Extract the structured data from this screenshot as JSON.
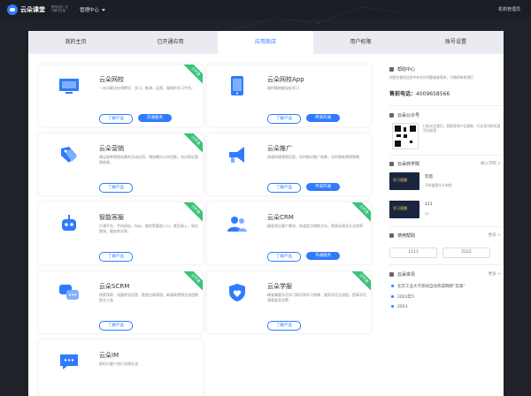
{
  "topbar": {
    "logo_text": "云朵课堂",
    "logo_sub": "教育培训一站式解决方案",
    "menu_label": "管理中心",
    "user_label": "机构管理员"
  },
  "tabs": [
    {
      "label": "我的主页",
      "active": false
    },
    {
      "label": "已开通应用",
      "active": false
    },
    {
      "label": "应用商店",
      "active": true
    },
    {
      "label": "用户权限",
      "active": false
    },
    {
      "label": "账号设置",
      "active": false
    }
  ],
  "cards": [
    {
      "name": "云朵网校",
      "icon": "monitor-icon",
      "desc": "一站式解决在线教学、学习、推课、运营、管理的学习平台。",
      "btn1": "了解产品",
      "btn2": "开通服务",
      "ribbon": "已开通"
    },
    {
      "name": "云朵网校App",
      "icon": "tablet-icon",
      "desc": "随时随地能轻松学习",
      "btn1": "了解产品",
      "btn2": "申请开通",
      "ribbon": ""
    },
    {
      "name": "云朵营销",
      "icon": "tags-icon",
      "desc": "满足各种营销场景的活动应用，增加曝光与学员数，充分保证营销效果。",
      "btn1": "了解产品",
      "btn2": "",
      "ribbon": "已开通"
    },
    {
      "name": "云朵推广",
      "icon": "megaphone-icon",
      "desc": "快速构建营销页面，实时统计推广效果，及时更新营销策略",
      "btn1": "了解产品",
      "btn2": "申请开通",
      "ribbon": ""
    },
    {
      "name": "智能客服",
      "icon": "robot-icon",
      "desc": "打通平台、手机网站、App、微信等渠道入口，就近接入，响应更快、服务转化率。",
      "btn1": "了解产品",
      "btn2": "",
      "ribbon": "已开通"
    },
    {
      "name": "云朵CRM",
      "icon": "users-icon",
      "desc": "精准到达客户需求，快速定位销售方向，提高业绩及企业效率",
      "btn1": "了解产品",
      "btn2": "开通服务",
      "ribbon": "已开通"
    },
    {
      "name": "云朵SCRM",
      "icon": "chat-bubbles-icon",
      "desc": "线索获取、流量转化运营、裂变拉新管理，新媒体营销全流程数智化工具",
      "btn1": "了解产品",
      "btn2": "",
      "ribbon": "已开通"
    },
    {
      "name": "云朵学服",
      "icon": "heart-shield-icon",
      "desc": "精准掌握学员学习情况和学习效果，服务学员全流程，提高学员满意度及续费",
      "btn1": "了解产品",
      "btn2": "",
      "ribbon": "已开通"
    },
    {
      "name": "云朵IM",
      "icon": "message-icon",
      "desc": "即时与客户进行沟通交流",
      "btn1": "",
      "btn2": "",
      "ribbon": ""
    }
  ],
  "sidebar": {
    "help_title": "帮助中心",
    "help_desc": "如您在使用过程中有任何问题或者需求，可随时联系我们",
    "phone_label": "售前电话：",
    "phone": "4009658566",
    "wechat_title": "云朵公众号",
    "wechat_desc": "扫码关注我们，获取更多产品更新、行业资讯和优惠活动信息",
    "academy_title": "云朵商学院",
    "academy_more": "进入学院 >",
    "academy_items": [
      {
        "thumb": "学习直播",
        "title": "年后",
        "sub": "不知道是什么的吧"
      },
      {
        "thumb": "学习直播",
        "title": "111",
        "sub": "22"
      }
    ],
    "hot_title": "使用帮助",
    "hot_more": "更多 >",
    "hot_items": [
      "1111",
      "2222"
    ],
    "news_title": "云朵资讯",
    "news_more": "更多 >",
    "news_items": [
      "北京工业大学测试自动完成网络“实践”",
      "2022年5",
      "2023"
    ]
  },
  "colors": {
    "accent": "#2f7bff",
    "ribbon": "#3ac27a",
    "topbar": "#1b1e25"
  }
}
